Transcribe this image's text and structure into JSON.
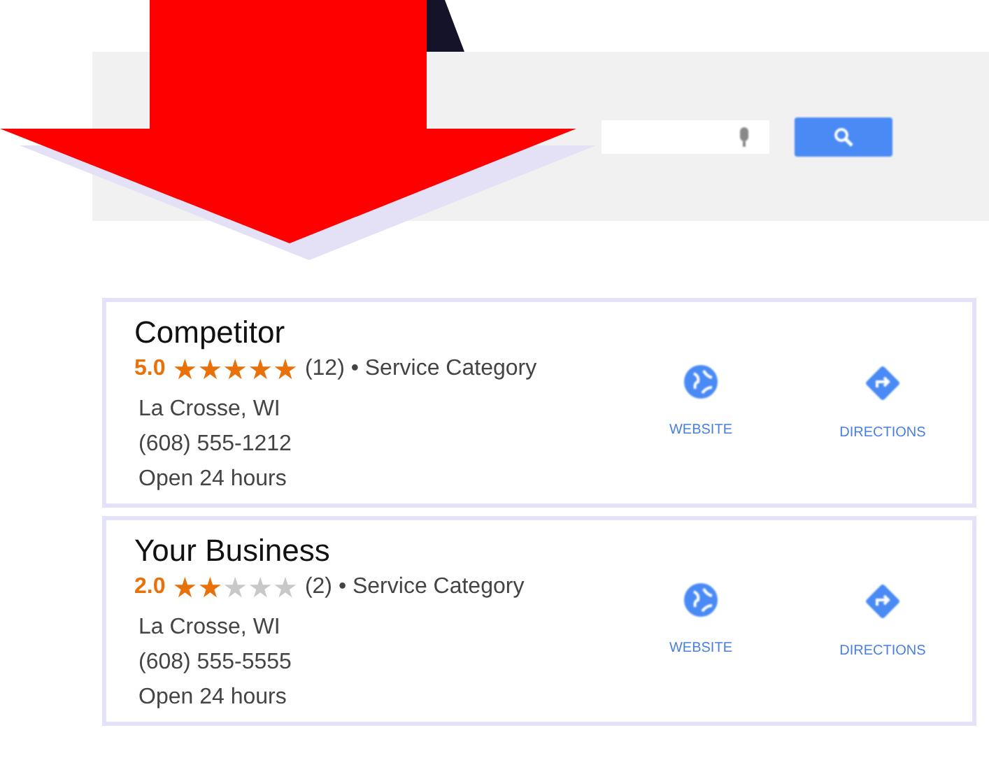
{
  "listings": [
    {
      "name": "Competitor",
      "rating": "5.0",
      "stars": 5,
      "meta": "(12) • Service Category",
      "address": "La Crosse, WI",
      "phone": "(608) 555-1212",
      "hours": "Open 24 hours",
      "actions": [
        {
          "kind": "website",
          "label": "WEBSITE"
        },
        {
          "kind": "directions",
          "label": "DIRECTIONS"
        }
      ]
    },
    {
      "name": "Your Business",
      "rating": "2.0",
      "stars": 2,
      "meta": "(2) • Service Category",
      "address": "La Crosse, WI",
      "phone": "(608) 555-5555",
      "hours": "Open 24 hours",
      "actions": [
        {
          "kind": "website",
          "label": "WEBSITE"
        },
        {
          "kind": "directions",
          "label": "DIRECTIONS"
        }
      ]
    }
  ]
}
